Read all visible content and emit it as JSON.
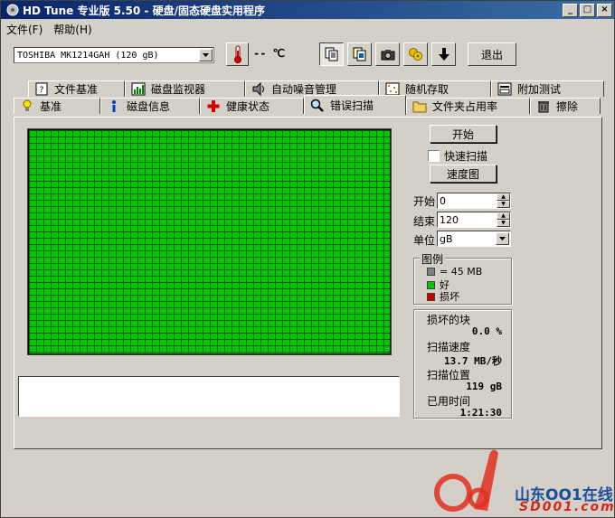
{
  "window": {
    "title": "HD Tune 专业版 5.50 - 硬盘/固态硬盘实用程序",
    "controls": {
      "minimize": "_",
      "maximize": "□",
      "close": "×"
    }
  },
  "menu": [
    "文件(F)",
    "帮助(H)"
  ],
  "toolbar": {
    "drive": "TOSHIBA MK1214GAH (120 gB)",
    "temperature": "-- ℃",
    "exit_label": "退出",
    "icons": [
      "thermometer-icon",
      "copy-text-icon",
      "copy-screen-icon",
      "screenshot-icon",
      "options-icon",
      "save-icon"
    ]
  },
  "tabs": {
    "top_row": [
      {
        "label": "文件基准",
        "icon": "file-benchmark-icon"
      },
      {
        "label": "磁盘监视器",
        "icon": "disk-monitor-icon"
      },
      {
        "label": "自动噪音管理",
        "icon": "speaker-icon"
      },
      {
        "label": "随机存取",
        "icon": "random-access-icon"
      },
      {
        "label": "附加测试",
        "icon": "extra-tests-icon"
      }
    ],
    "bottom_row": [
      {
        "label": "基准",
        "icon": "benchmark-icon"
      },
      {
        "label": "磁盘信息",
        "icon": "info-icon"
      },
      {
        "label": "健康状态",
        "icon": "health-icon"
      },
      {
        "label": "错误扫描",
        "icon": "magnifier-icon",
        "active": true
      },
      {
        "label": "文件夹占用率",
        "icon": "folder-icon"
      },
      {
        "label": "擦除",
        "icon": "trash-icon"
      }
    ]
  },
  "scan": {
    "start_button": "开始",
    "quick_scan_label": "快速扫描",
    "quick_scan_checked": false,
    "speed_map_button": "速度图",
    "start_label": "开始",
    "start_value": "0",
    "end_label": "结束",
    "end_value": "120",
    "unit_label": "单位",
    "unit_value": "gB"
  },
  "legend": {
    "title": "图例",
    "block_size": "= 45 MB",
    "good": "好",
    "bad": "损坏",
    "colors": {
      "block": "#808080",
      "good": "#00c800",
      "bad": "#c80000"
    }
  },
  "stats": {
    "damaged_label": "损坏的块",
    "damaged_value": "0.0 %",
    "speed_label": "扫描速度",
    "speed_value": "13.7 MB/秒",
    "position_label": "扫描位置",
    "position_value": "119 gB",
    "elapsed_label": "已用时间",
    "elapsed_value": "1:21:30"
  },
  "watermark": {
    "name": "山东OO1在线",
    "site": "SD001.com"
  }
}
